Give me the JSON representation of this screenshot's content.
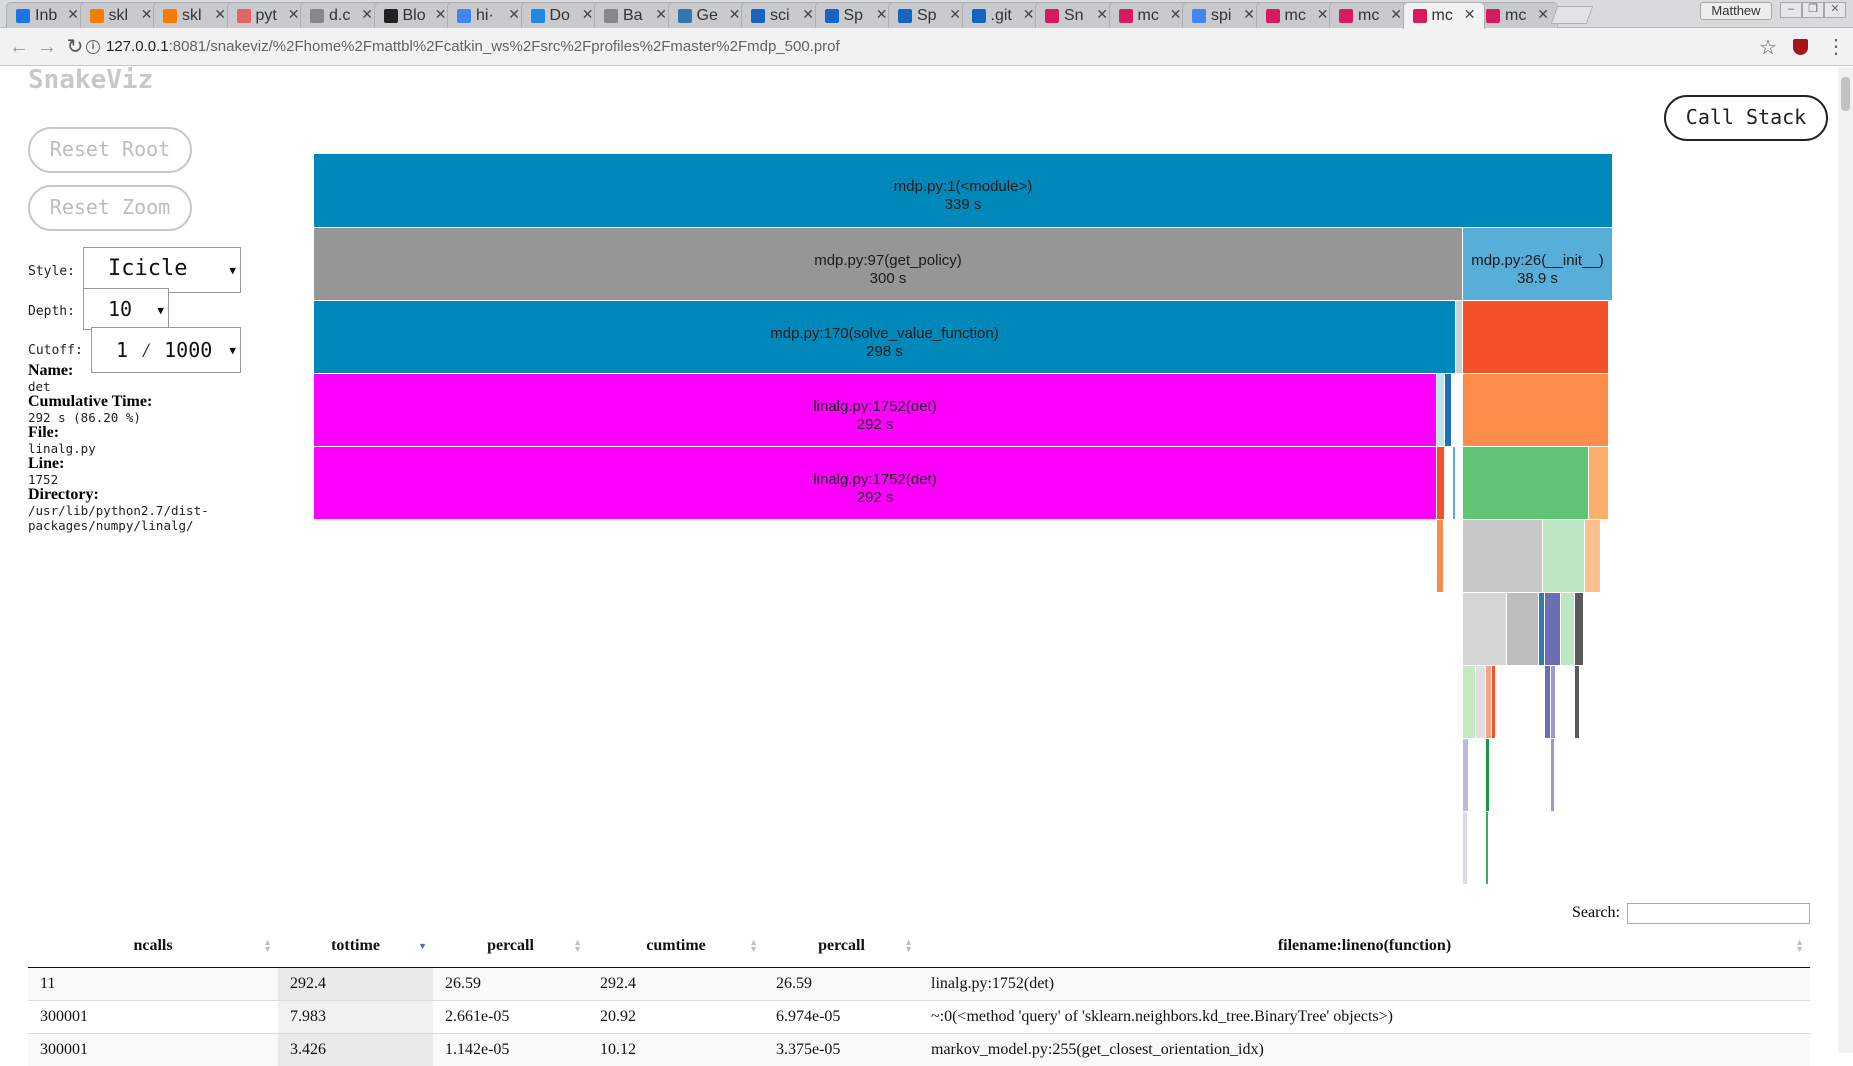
{
  "browser": {
    "tabs": [
      {
        "title": "Inb",
        "color": "#1a73e8"
      },
      {
        "title": "skl",
        "color": "#f57c00"
      },
      {
        "title": "skl",
        "color": "#f57c00"
      },
      {
        "title": "pyt",
        "color": "#e06666"
      },
      {
        "title": "d.c",
        "color": "#888888"
      },
      {
        "title": "Blo",
        "color": "#222222"
      },
      {
        "title": "hi·",
        "color": "#4285f4"
      },
      {
        "title": "Do",
        "color": "#1e88e5"
      },
      {
        "title": "Ba",
        "color": "#888888"
      },
      {
        "title": "Ge",
        "color": "#3776ab"
      },
      {
        "title": "sci",
        "color": "#1565c0"
      },
      {
        "title": "Sp",
        "color": "#1565c0"
      },
      {
        "title": "Sp",
        "color": "#1565c0"
      },
      {
        "title": ".git",
        "color": "#1565c0"
      },
      {
        "title": "Sn",
        "color": "#d81b60"
      },
      {
        "title": "mc",
        "color": "#d81b60"
      },
      {
        "title": "spi",
        "color": "#4285f4"
      },
      {
        "title": "mc",
        "color": "#d81b60"
      },
      {
        "title": "mc",
        "color": "#d81b60"
      },
      {
        "title": "mc",
        "color": "#d81b60",
        "active": true
      },
      {
        "title": "mc",
        "color": "#d81b60"
      }
    ],
    "profile": "Matthew",
    "url_host": "127.0.0.1",
    "url_rest": ":8081/snakeviz/%2Fhome%2Fmattbl%2Fcatkin_ws%2Fsrc%2Fprofiles%2Fmaster%2Fmdp_500.prof"
  },
  "app": {
    "brand": "SnakeViz",
    "reset_root": "Reset Root",
    "reset_zoom": "Reset Zoom",
    "call_stack": "Call Stack",
    "style_label": "Style:",
    "style_value": "Icicle",
    "depth_label": "Depth:",
    "depth_value": "10",
    "cutoff_label": "Cutoff:",
    "cutoff_value": "1 ⁄ 1000"
  },
  "info": {
    "name_label": "Name:",
    "name": "det",
    "cum_label": "Cumulative Time:",
    "cum": "292 s (86.20 %)",
    "file_label": "File:",
    "file": "linalg.py",
    "line_label": "Line:",
    "line": "1752",
    "dir_label": "Directory:",
    "dir": "/usr/lib/python2.7/dist-packages/numpy/linalg/"
  },
  "icicle": {
    "labels": {
      "module": "mdp.py:1(<module>)",
      "module_time": "339 s",
      "get_policy": "mdp.py:97(get_policy)",
      "get_policy_time": "300 s",
      "init": "mdp.py:26(__init__)",
      "init_time": "38.9 s",
      "solve": "mdp.py:170(solve_value_function)",
      "solve_time": "298 s",
      "det1": "linalg.py:1752(det)",
      "det1_time": "292 s",
      "det2": "linalg.py:1752(det)",
      "det2_time": "292 s"
    },
    "colors": {
      "blue": "#0088bb",
      "gray": "#969696",
      "lightblue": "#56aed9",
      "magenta": "#ff00ff",
      "red": "#f4502a",
      "orange": "#fd8b49",
      "green": "#5fc474",
      "lightgray": "#d0d0d0"
    }
  },
  "table": {
    "search_label": "Search:",
    "headers": [
      "ncalls",
      "tottime",
      "percall",
      "cumtime",
      "percall",
      "filename:lineno(function)"
    ],
    "rows": [
      [
        "11",
        "292.4",
        "26.59",
        "292.4",
        "26.59",
        "linalg.py:1752(det)"
      ],
      [
        "300001",
        "7.983",
        "2.661e-05",
        "20.92",
        "6.974e-05",
        "~:0(<method 'query' of 'sklearn.neighbors.kd_tree.BinaryTree' objects>)"
      ],
      [
        "300001",
        "3.426",
        "1.142e-05",
        "10.12",
        "3.375e-05",
        "markov_model.py:255(get_closest_orientation_idx)"
      ]
    ]
  }
}
